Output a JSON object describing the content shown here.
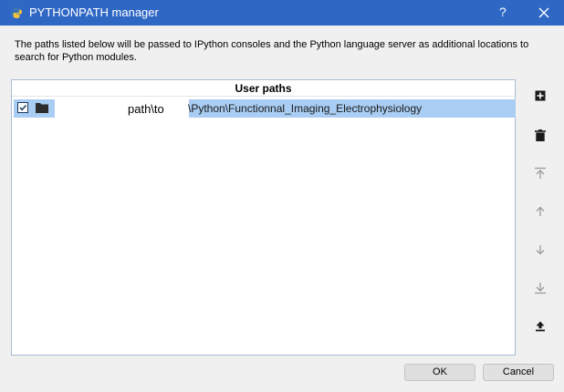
{
  "window": {
    "title": "PYTHONPATH manager",
    "help_label": "?"
  },
  "description": "The paths listed below will be passed to IPython consoles and the Python language server as additional locations to search for Python modules.",
  "list": {
    "header": "User paths",
    "rows": [
      {
        "checked": true,
        "redacted_visible_text": "path\\to",
        "path_suffix": "\\Python\\Functionnal_Imaging_Electrophysiology"
      }
    ]
  },
  "toolbar": {
    "icons": [
      "add-path-icon",
      "remove-path-icon",
      "move-to-top-icon",
      "move-up-icon",
      "move-down-icon",
      "move-to-bottom-icon",
      "export-icon"
    ]
  },
  "buttons": {
    "ok_label": "OK",
    "cancel_label": "Cancel"
  },
  "colors": {
    "titlebar": "#2f67c5",
    "selection": "#a9cdf3",
    "panel_border": "#a9bcd7"
  }
}
